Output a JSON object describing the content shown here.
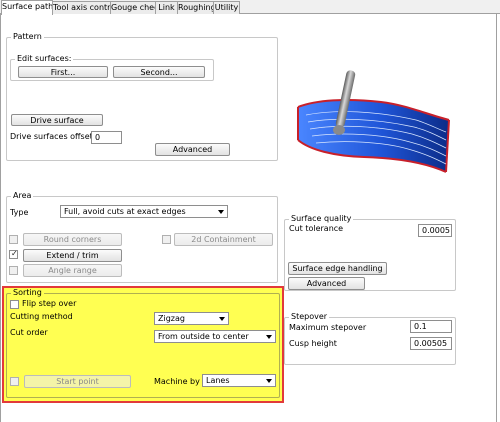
{
  "tabs": [
    "Surface paths",
    "Tool axis control",
    "Gouge check",
    "Link",
    "Roughing",
    "Utility"
  ],
  "active_tab": "Surface paths",
  "pattern": {
    "title": "Pattern",
    "edit_label": "Edit surfaces:",
    "first_button": "First...",
    "second_button": "Second...",
    "drive_surface_button": "Drive surface",
    "offset_label": "Drive surfaces offset",
    "offset_value": "0",
    "advanced_button": "Advanced"
  },
  "area": {
    "title": "Area",
    "type_label": "Type",
    "type_value": "Full, avoid cuts at exact edges",
    "round_corners": "Round corners",
    "containment_2d": "2d Containment",
    "extend_trim": "Extend / trim",
    "angle_range": "Angle range"
  },
  "surface_quality": {
    "title": "Surface quality",
    "cut_tolerance_label": "Cut tolerance",
    "cut_tolerance_value": "0.0005",
    "edge_handling_button": "Surface edge handling",
    "advanced_button": "Advanced"
  },
  "sorting": {
    "title": "Sorting",
    "flip_step_over": "Flip step over",
    "cutting_method_label": "Cutting method",
    "cutting_method_value": "Zigzag",
    "cut_order_label": "Cut order",
    "cut_order_value": "From outside to center",
    "start_point_button": "Start point",
    "machine_by_label": "Machine by",
    "machine_by_value": "Lanes"
  },
  "stepover": {
    "title": "Stepover",
    "max_stepover_label": "Maximum stepover",
    "max_stepover_value": "0.1",
    "cusp_height_label": "Cusp height",
    "cusp_height_value": "0.00505"
  },
  "colors": {
    "highlight_fill": "#ffff52",
    "highlight_border": "#e23a3a",
    "surface_blue": "#1f55d8",
    "edge_red": "#c8202a"
  }
}
